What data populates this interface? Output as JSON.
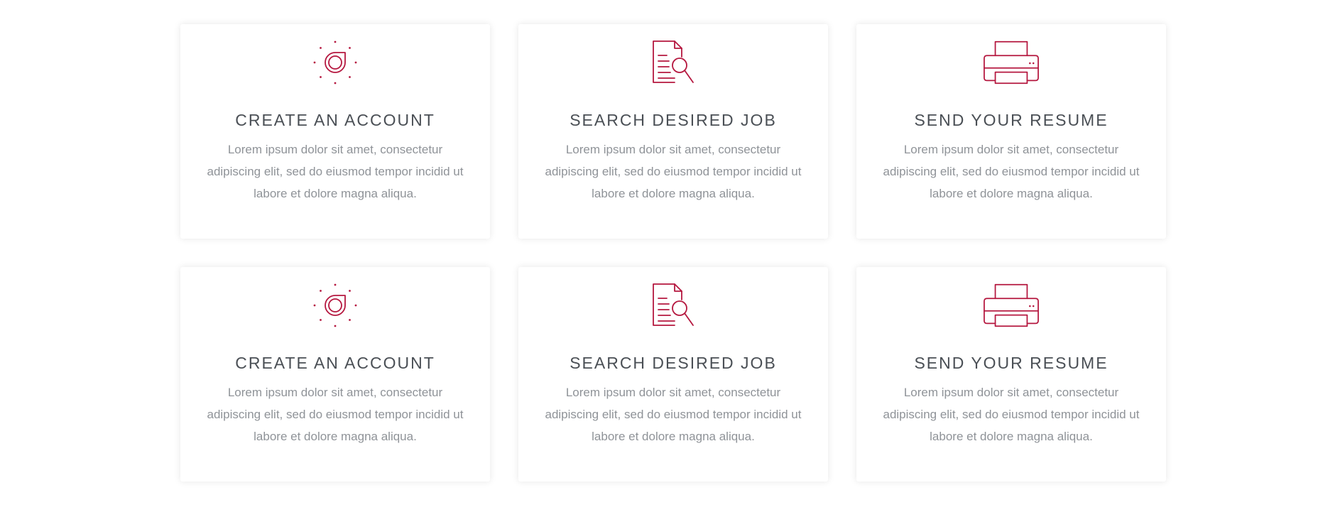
{
  "colors": {
    "accent": "#b5173f",
    "title": "#4a4f55",
    "text": "#8f9398",
    "card_background": "#ffffff",
    "page_background": "#ffffff"
  },
  "cards": [
    {
      "icon": "account-icon",
      "title": "CREATE AN ACCOUNT",
      "text": "Lorem ipsum dolor sit amet, consectetur adipiscing elit, sed do eiusmod tempor incidid ut labore et dolore magna aliqua."
    },
    {
      "icon": "search-document-icon",
      "title": "SEARCH DESIRED JOB",
      "text": "Lorem ipsum dolor sit amet, consectetur adipiscing elit, sed do eiusmod tempor incidid ut labore et dolore magna aliqua."
    },
    {
      "icon": "printer-icon",
      "title": "SEND YOUR RESUME",
      "text": "Lorem ipsum dolor sit amet, consectetur adipiscing elit, sed do eiusmod tempor incidid ut labore et dolore magna aliqua."
    },
    {
      "icon": "account-icon",
      "title": "CREATE AN ACCOUNT",
      "text": "Lorem ipsum dolor sit amet, consectetur adipiscing elit, sed do eiusmod tempor incidid ut labore et dolore magna aliqua."
    },
    {
      "icon": "search-document-icon",
      "title": "SEARCH DESIRED JOB",
      "text": "Lorem ipsum dolor sit amet, consectetur adipiscing elit, sed do eiusmod tempor incidid ut labore et dolore magna aliqua."
    },
    {
      "icon": "printer-icon",
      "title": "SEND YOUR RESUME",
      "text": "Lorem ipsum dolor sit amet, consectetur adipiscing elit, sed do eiusmod tempor incidid ut labore et dolore magna aliqua."
    }
  ]
}
